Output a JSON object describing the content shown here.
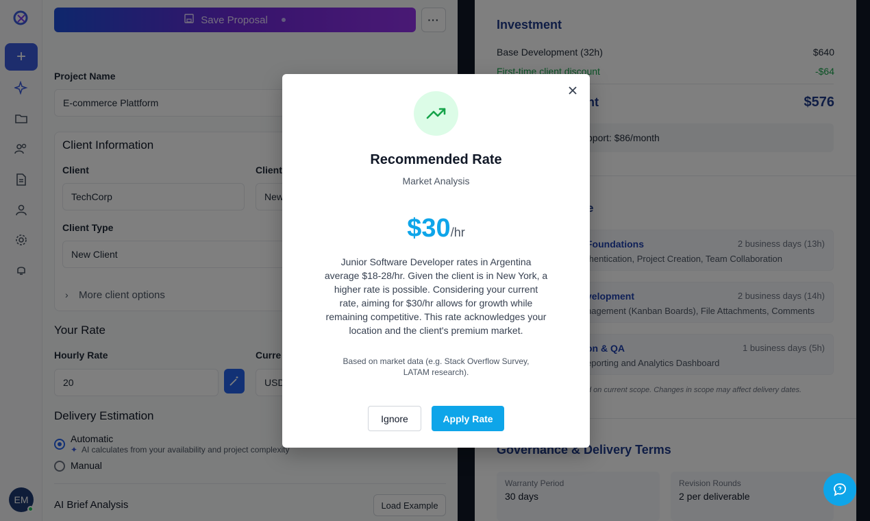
{
  "colors": {
    "accent": "#0ea5e9",
    "brand": "#3b5bdb",
    "success": "#22c55e",
    "discount": "#16a34a"
  },
  "sidebar": {
    "icons": [
      "logo-icon",
      "plus-icon",
      "sparkles-icon",
      "folder-icon",
      "users-icon",
      "document-icon",
      "user-icon",
      "gear-icon",
      "bell-icon"
    ],
    "avatar_initials": "EM"
  },
  "toolbar": {
    "save_label": "Save Proposal",
    "more_label": "···"
  },
  "form": {
    "project_name_label": "Project Name",
    "project_name_value": "E-commerce Plattform",
    "client_info_title": "Client Information",
    "client_label": "Client",
    "client_value": "TechCorp",
    "client_secondary_label": "Client",
    "client_secondary_value": "New",
    "client_type_label": "Client Type",
    "client_type_value": "New Client",
    "more_options": "More client options",
    "your_rate_title": "Your Rate",
    "hourly_rate_label": "Hourly Rate",
    "hourly_rate_value": "20",
    "currency_label": "Curre",
    "currency_value": "USD",
    "delivery_title": "Delivery Estimation",
    "automatic_label": "Automatic",
    "automatic_hint": "AI calculates from your availability and project complexity",
    "manual_label": "Manual",
    "ai_brief_title": "AI Brief Analysis",
    "load_example": "Load Example"
  },
  "investment": {
    "title": "Investment",
    "base_label": "Base Development (32h)",
    "base_value": "$640",
    "discount_label": "First-time client discount",
    "discount_value": "-$64",
    "total_label_partial": "nt",
    "total_value": "$576",
    "support_text": "pport: $86/month",
    "timeline_partial": "e",
    "phases": [
      {
        "title": "Foundations",
        "desc": "thentication, Project Creation, Team Collaboration",
        "duration": "2 business days (13h)"
      },
      {
        "title": "velopment",
        "desc": "nagement (Kanban Boards), File Attachments, Comments",
        "duration": "2 business days (14h)"
      },
      {
        "title": "on & QA",
        "desc": "eporting and Analytics Dashboard",
        "duration": "1 business days (5h)"
      }
    ],
    "scope_note": "d on current scope. Changes in scope may affect delivery dates."
  },
  "governance": {
    "title": "Governance & Delivery Terms",
    "warranty_label": "Warranty Period",
    "warranty_value": "30 days",
    "revision_label": "Revision Rounds",
    "revision_value": "2 per deliverable"
  },
  "modal": {
    "title": "Recommended Rate",
    "subtitle": "Market Analysis",
    "rate_value": "$30",
    "rate_unit": "/hr",
    "description": "Junior Software Developer rates in Argentina average $18-28/hr. Given the client is in New York, a higher rate is possible. Considering your current rate, aiming for $30/hr allows for growth while remaining competitive. This rate acknowledges your location and the client's premium market.",
    "source": "Based on market data (e.g. Stack Overflow Survey, LATAM research).",
    "ignore_label": "Ignore",
    "apply_label": "Apply Rate"
  }
}
